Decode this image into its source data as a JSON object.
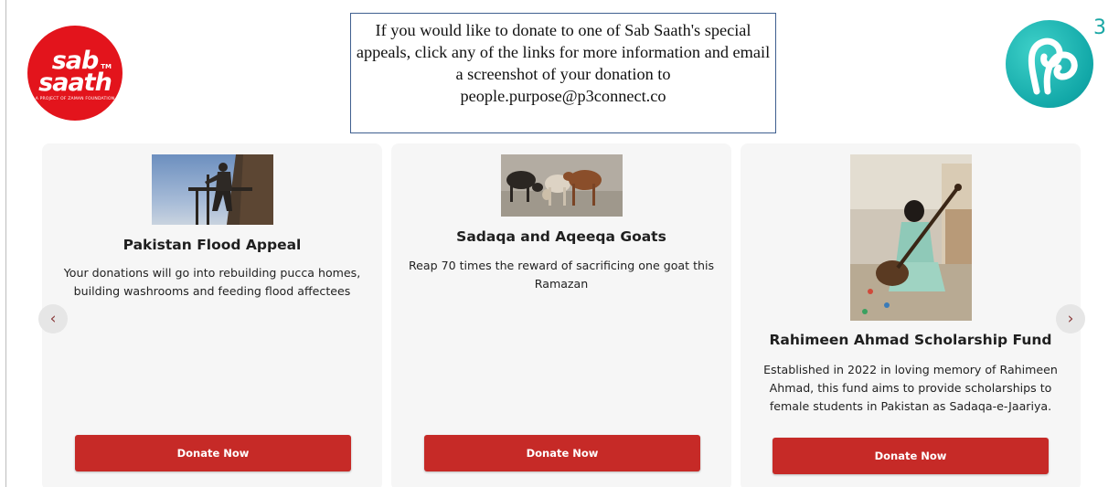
{
  "logos": {
    "sab_saath": {
      "line1": "sab",
      "line2": "saath",
      "trademark": "TM",
      "tagline": "A PROJECT OF ZAMAN FOUNDATION",
      "color": "#e3141c"
    },
    "p3": {
      "superscript": "3",
      "color": "#12a8a8"
    }
  },
  "info_box": {
    "text": "If you would like to donate to one of Sab Saath's special appeals, click any of the links for more information and email a screenshot of your donation to people.purpose@p3connect.co"
  },
  "carousel": {
    "prev_icon": "chevron-left-icon",
    "next_icon": "chevron-right-icon",
    "prev_glyph": "‹",
    "next_glyph": "›"
  },
  "cards": [
    {
      "title": "Pakistan Flood Appeal",
      "description": "Your donations will go into rebuilding pucca homes, building washrooms and feeding flood affectees",
      "button_label": "Donate Now",
      "image": "worker-on-scaffold-photo"
    },
    {
      "title": "Sadaqa and Aqeeqa Goats",
      "description": "Reap 70 times the reward of sacrificing one goat this Ramazan",
      "button_label": "Donate Now",
      "image": "goats-photo"
    },
    {
      "title": "Rahimeen Ahmad Scholarship Fund",
      "description": "Established in 2022 in loving memory of Rahimeen Ahmad, this fund aims to provide scholarships to female students in Pakistan as Sadaqa-e-Jaariya.",
      "button_label": "Donate Now",
      "image": "girl-playing-sitar-photo"
    }
  ],
  "colors": {
    "button": "#c62a27",
    "card_background": "#f6f6f6",
    "info_border": "#3f5f8f"
  }
}
